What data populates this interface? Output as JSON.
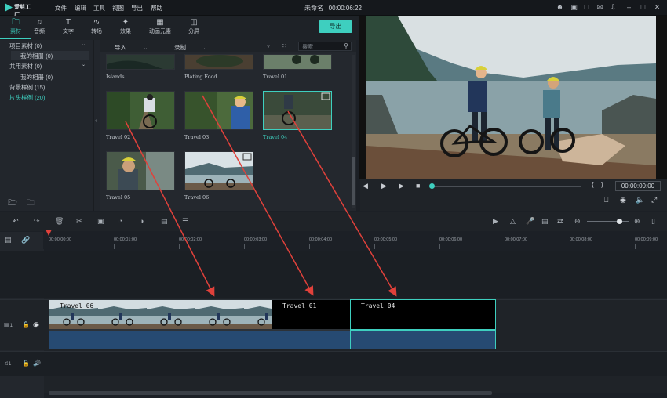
{
  "app": {
    "logo_text": "爱剪工厂",
    "menu": [
      "文件",
      "编辑",
      "工具",
      "视图",
      "导出",
      "帮助"
    ],
    "title": "未命名 : 00:00:06:22"
  },
  "tabs": [
    {
      "label": "素材",
      "icon": "folder-icon"
    },
    {
      "label": "音频",
      "icon": "music-note-icon"
    },
    {
      "label": "文字",
      "icon": "text-icon"
    },
    {
      "label": "转场",
      "icon": "transition-icon"
    },
    {
      "label": "效果",
      "icon": "effects-icon"
    },
    {
      "label": "动画元素",
      "icon": "image-icon"
    },
    {
      "label": "分屏",
      "icon": "split-screen-icon"
    }
  ],
  "export_label": "导出",
  "tree": [
    {
      "label": "项目素材 (0)"
    },
    {
      "label": "我的相册 (0)"
    },
    {
      "label": "共用素材 (0)"
    },
    {
      "label": "我的相册 (0)"
    },
    {
      "label": "背景样例 (15)"
    },
    {
      "label": "片头样例 (20)"
    }
  ],
  "content_toolbar": {
    "import": "导入",
    "record": "录制",
    "search_placeholder": "搜索"
  },
  "media": [
    {
      "label": "Islands"
    },
    {
      "label": "Plating Food"
    },
    {
      "label": "Travel 01"
    },
    {
      "label": "Travel 02"
    },
    {
      "label": "Travel 03"
    },
    {
      "label": "Travel 04"
    },
    {
      "label": "Travel 05"
    },
    {
      "label": "Travel 06"
    }
  ],
  "preview": {
    "timecode": "00:00:00:00"
  },
  "ruler": [
    "00:00:00:00",
    "00:00:01:00",
    "00:00:02:00",
    "00:00:03:00",
    "00:00:04:00",
    "00:00:05:00",
    "00:00:06:00",
    "00:00:07:00",
    "00:00:08:00",
    "00:00:09:00"
  ],
  "clips": [
    {
      "label": "Travel_06"
    },
    {
      "label": "Travel_01"
    },
    {
      "label": "Travel_04"
    }
  ],
  "tracks": {
    "video_num": "1",
    "audio_num": "1"
  },
  "colors": {
    "accent": "#3ecfbf",
    "arrow": "#e0413b",
    "audio": "#264a72"
  }
}
